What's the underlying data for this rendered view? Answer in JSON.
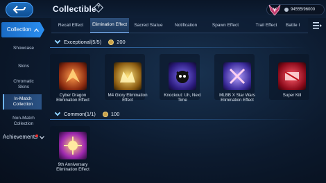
{
  "header": {
    "title": "Collectible",
    "help_symbol": "?",
    "currency_value": "94555/96000"
  },
  "tabs": [
    {
      "label": "Recall Effect",
      "active": false
    },
    {
      "label": "Elimination Effect",
      "active": true
    },
    {
      "label": "Sacred Statue",
      "active": false
    },
    {
      "label": "Notification",
      "active": false
    },
    {
      "label": "Spawn Effect",
      "active": false
    },
    {
      "label": "Trail Effect",
      "active": false
    },
    {
      "label": "Battle I",
      "active": false
    }
  ],
  "sidebar": {
    "main_label": "Collection",
    "items": [
      {
        "label": "Showcase"
      },
      {
        "label": "Skins"
      },
      {
        "label": "Chromatic Skins"
      },
      {
        "label": "In-Match Collection",
        "selected": true
      },
      {
        "label": "Non-Match Collection"
      }
    ],
    "achievements_label": "Achievements"
  },
  "sections": [
    {
      "title": "Exceptional(5/5)",
      "points": "200",
      "items": [
        {
          "label": "Cyber Dragon Elimination Effect",
          "accent": "#e0552a"
        },
        {
          "label": "M4 Glory Elimination Effect",
          "accent": "#e6b62a"
        },
        {
          "label": "Knockout: Uh, Next Time",
          "accent": "#5a3fd1"
        },
        {
          "label": "MLBB X Star Wars Elimination Effect",
          "accent": "#6a4fe0"
        },
        {
          "label": "Super Kill",
          "accent": "#d12a3a"
        }
      ]
    },
    {
      "title": "Common(1/1)",
      "points": "100",
      "items": [
        {
          "label": "9th Anniversary Elimination Effect",
          "accent": "#c84ad8"
        }
      ]
    }
  ],
  "colors": {
    "accent_blue": "#2a8ef0",
    "background": "#0c1a2e",
    "coin_gold": "#c9a24a"
  }
}
